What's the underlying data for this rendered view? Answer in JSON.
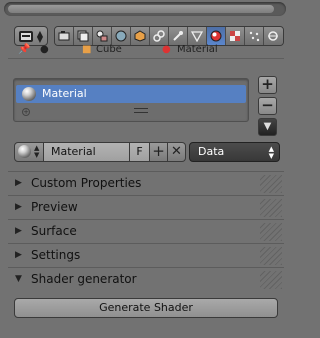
{
  "context": {
    "object_name": "Cube",
    "material_name": "Material"
  },
  "material_slots": {
    "items": [
      {
        "label": "Material",
        "selected": true
      }
    ]
  },
  "material_row": {
    "name": "Material",
    "fake_user": "F",
    "link": "Data"
  },
  "sections": [
    {
      "title": "Custom Properties",
      "expanded": false
    },
    {
      "title": "Preview",
      "expanded": false
    },
    {
      "title": "Surface",
      "expanded": false
    },
    {
      "title": "Settings",
      "expanded": false
    },
    {
      "title": "Shader generator",
      "expanded": true
    }
  ],
  "actions": {
    "generate_shader": "Generate Shader"
  },
  "icons": {
    "toolbar": [
      "render-icon",
      "render-layers-icon",
      "scene-icon",
      "world-icon",
      "object-icon",
      "constraints-icon",
      "modifiers-icon",
      "data-icon",
      "material-icon",
      "texture-icon",
      "particles-icon",
      "physics-icon"
    ]
  },
  "colors": {
    "panel_bg": "#727272",
    "selection": "#5680c2",
    "active_tab": "#5b86cc"
  }
}
